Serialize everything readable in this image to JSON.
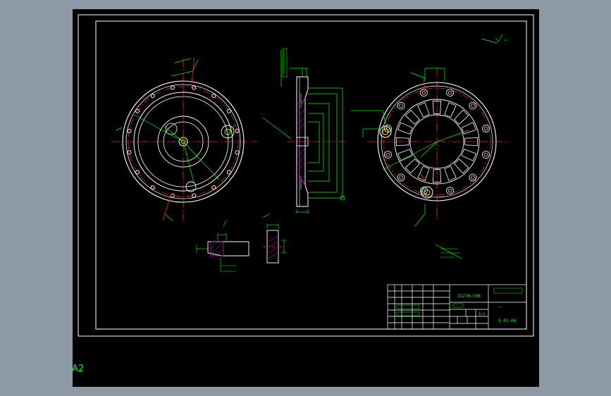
{
  "title_block": {
    "part_number": "ZG270-500",
    "scale": "1:2",
    "drawing_number": "0-01-06",
    "material_note": "——"
  },
  "sheet": {
    "size_label": "A2"
  },
  "colors": {
    "background": "#000000",
    "frame": "#ffffff",
    "outline": "#ffffff",
    "center_line": "#ff2020",
    "dimension": "#00ff00",
    "hidden": "#ffff00",
    "hatch": "#ff00ff",
    "workspace": "#8d9aa6"
  }
}
